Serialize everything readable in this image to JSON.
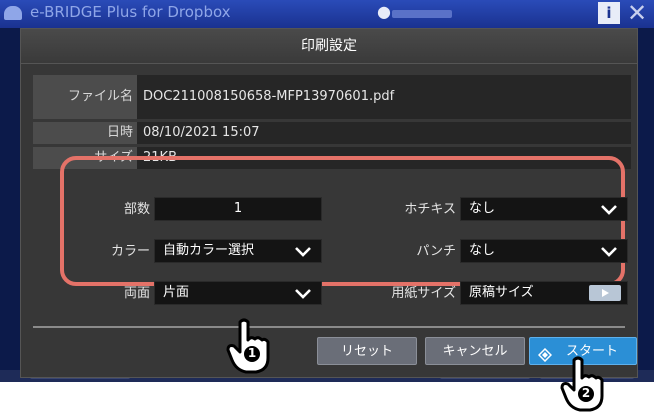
{
  "app": {
    "title": "e-BRIDGE Plus for Dropbox",
    "info_icon": "i",
    "close_icon": "✕"
  },
  "dialog": {
    "title": "印刷設定"
  },
  "file_info": {
    "rows": [
      {
        "label": "ファイル名",
        "value": "DOC211008150658-MFP13970601.pdf"
      },
      {
        "label": "日時",
        "value": "08/10/2021 15:07"
      },
      {
        "label": "サイズ",
        "value": "21KB"
      }
    ]
  },
  "settings": {
    "copies_label": "部数",
    "copies_value": "1",
    "color_label": "カラー",
    "color_value": "自動カラー選択",
    "duplex_label": "両面",
    "duplex_value": "片面",
    "staple_label": "ホチキス",
    "staple_value": "なし",
    "punch_label": "パンチ",
    "punch_value": "なし",
    "paper_label": "用紙サイズ",
    "paper_value": "原稿サイズ"
  },
  "buttons": {
    "reset": "リセット",
    "cancel": "キャンセル",
    "start": "スタート"
  },
  "annotations": {
    "step1": "1",
    "step2": "2"
  },
  "colors": {
    "highlight": "#e47268",
    "start_button": "#2b8fd6",
    "dialog_bg": "#373737",
    "app_bg": "#0c1a4a"
  }
}
